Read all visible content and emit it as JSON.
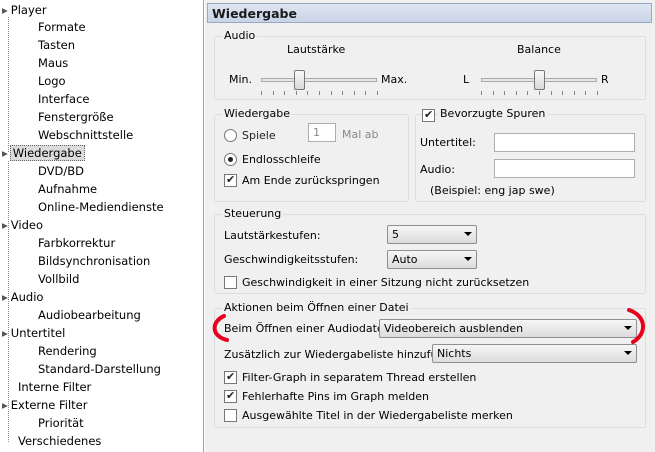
{
  "tree": {
    "items": [
      {
        "label": "Player",
        "expander": "-"
      },
      {
        "label": "Formate"
      },
      {
        "label": "Tasten"
      },
      {
        "label": "Maus"
      },
      {
        "label": "Logo"
      },
      {
        "label": "Interface"
      },
      {
        "label": "Fenstergröße"
      },
      {
        "label": "Webschnittstelle"
      },
      {
        "label": "Wiedergabe",
        "expander": "-",
        "selected": true
      },
      {
        "label": "DVD/BD"
      },
      {
        "label": "Aufnahme"
      },
      {
        "label": "Online-Mediendienste"
      },
      {
        "label": "Video",
        "expander": "-"
      },
      {
        "label": "Farbkorrektur"
      },
      {
        "label": "Bildsynchronisation"
      },
      {
        "label": "Vollbild"
      },
      {
        "label": "Audio",
        "expander": "-"
      },
      {
        "label": "Audiobearbeitung"
      },
      {
        "label": "Untertitel",
        "expander": "-"
      },
      {
        "label": "Rendering"
      },
      {
        "label": "Standard-Darstellung"
      },
      {
        "label": "Interne Filter"
      },
      {
        "label": "Externe Filter",
        "expander": "-"
      },
      {
        "label": "Priorität"
      },
      {
        "label": "Verschiedenes"
      }
    ]
  },
  "page": {
    "title": "Wiedergabe"
  },
  "audio": {
    "group": "Audio",
    "volume_label": "Lautstärke",
    "min": "Min.",
    "max": "Max.",
    "volume_level": 0.33,
    "balance_label": "Balance",
    "left": "L",
    "right": "R",
    "balance_level": 0.5
  },
  "playback": {
    "group": "Wiedergabe",
    "play_label": "Spiele",
    "play_count": "1",
    "play_suffix": "Mal ab",
    "loop_label": "Endlosschleife",
    "rewind_label": "Am Ende zurückspringen"
  },
  "tracks": {
    "group": "Bevorzugte Spuren",
    "subtitle_label": "Untertitel:",
    "audio_label": "Audio:",
    "example": "(Beispiel: eng jap swe)"
  },
  "control": {
    "group": "Steuerung",
    "volume_steps_label": "Lautstärkestufen:",
    "volume_steps_value": "5",
    "speed_steps_label": "Geschwindigkeitsstufen:",
    "speed_steps_value": "Auto",
    "no_reset_label": "Geschwindigkeit in einer Sitzung nicht zurücksetzen"
  },
  "open_actions": {
    "group": "Aktionen beim Öffnen einer Datei",
    "audio_file_label": "Beim Öffnen einer Audiodatei,",
    "audio_file_value": "Videobereich ausblenden",
    "playlist_label": "Zusätzlich zur Wiedergabeliste hinzufügen:",
    "playlist_value": "Nichts",
    "filter_thread_label": "Filter-Graph in separatem Thread erstellen",
    "bad_pins_label": "Fehlerhafte Pins im Graph melden",
    "remember_titles_label": "Ausgewählte Titel in der Wiedergabeliste merken"
  },
  "annotation": {
    "color": "#e8001c"
  }
}
